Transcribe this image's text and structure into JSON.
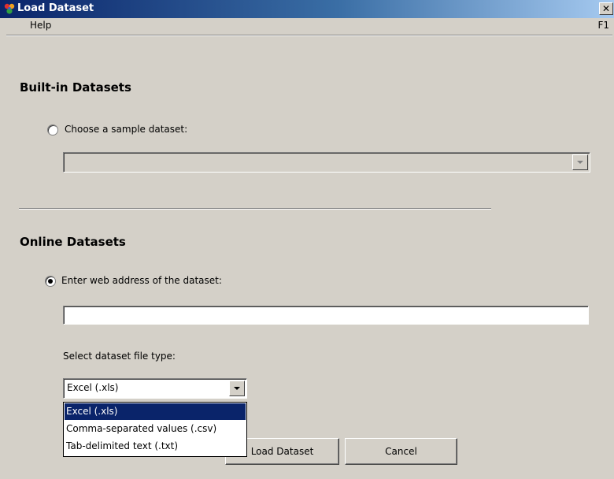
{
  "window": {
    "title": "Load Dataset",
    "close_glyph": "✕",
    "icon": "colorful-app-icon"
  },
  "menu": {
    "help_label": "Help",
    "shortcut_label": "F1"
  },
  "builtin": {
    "section_title": "Built-in Datasets",
    "radio_label": "Choose a sample dataset:",
    "radio_selected": false,
    "dropdown_value": ""
  },
  "online": {
    "section_title": "Online Datasets",
    "radio_label": "Enter web address of the dataset:",
    "radio_selected": true,
    "url_value": "",
    "filetype_label": "Select dataset file type:",
    "filetype_value": "Excel (.xls)",
    "filetype_options": [
      "Excel (.xls)",
      "Comma-separated values (.csv)",
      "Tab-delimited text (.txt)"
    ],
    "filetype_highlighted": "Excel (.xls)"
  },
  "buttons": {
    "load_label": "Load Dataset",
    "cancel_label": "Cancel"
  },
  "colors": {
    "window_bg": "#d4d0c8",
    "titlebar_start": "#0a246a",
    "titlebar_end": "#a6caf0",
    "selection": "#0a246a"
  }
}
